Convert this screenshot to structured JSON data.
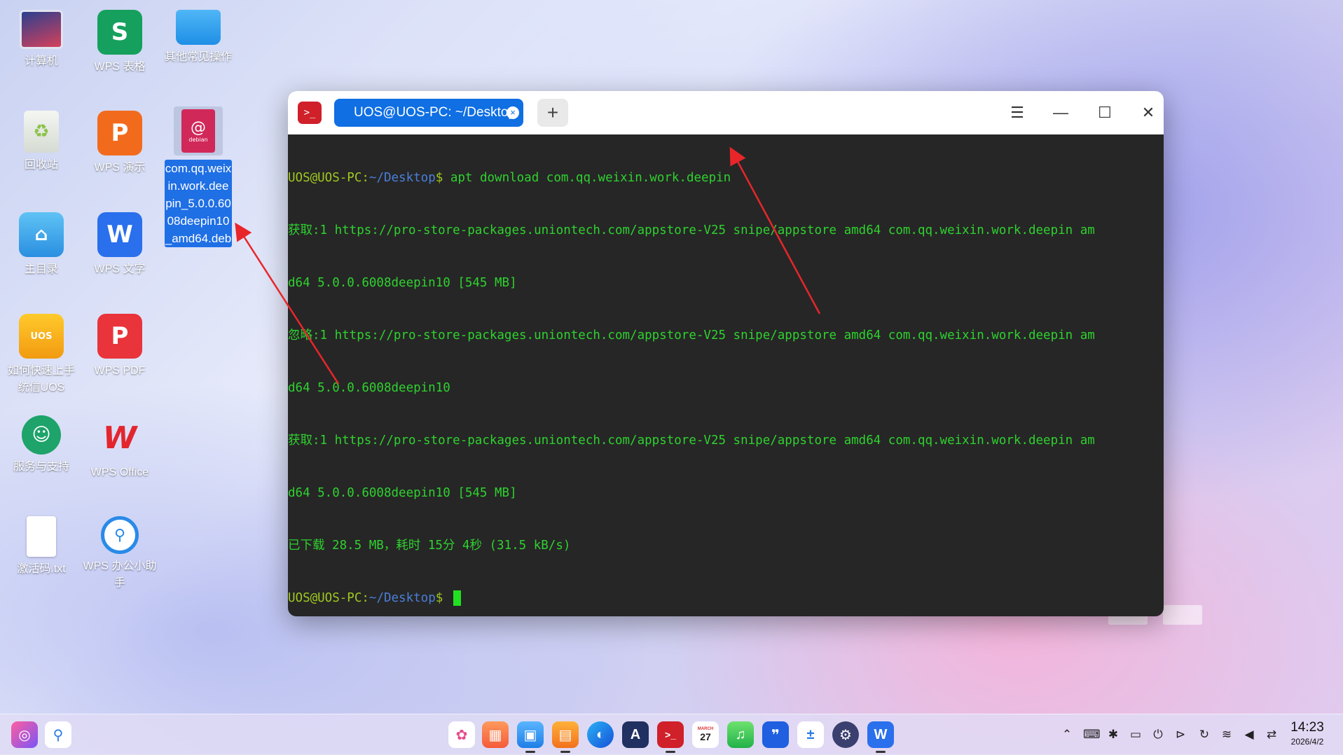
{
  "desktop": {
    "icons": [
      {
        "label": "计算机",
        "icon": "computer-icon"
      },
      {
        "label": "WPS 表格",
        "icon": "wps-spreadsheet-icon"
      },
      {
        "label": "其他常见操作",
        "icon": "folder-icon"
      },
      {
        "label": "回收站",
        "icon": "trash-icon"
      },
      {
        "label": "WPS 演示",
        "icon": "wps-presentation-icon"
      },
      {
        "label": "com.qq.weixin.work.deepin_5.0.0.6008deepin10_amd64.deb",
        "icon": "deb-package-icon"
      },
      {
        "label": "主目录",
        "icon": "home-folder-icon"
      },
      {
        "label": "WPS 文字",
        "icon": "wps-writer-icon"
      },
      {
        "label": "如何快速上手统信UOS",
        "icon": "uos-guide-icon"
      },
      {
        "label": "WPS PDF",
        "icon": "wps-pdf-icon"
      },
      {
        "label": "服务与支持",
        "icon": "support-icon"
      },
      {
        "label": "WPS Office",
        "icon": "wps-office-icon"
      },
      {
        "label": "激活码.txt",
        "icon": "text-file-icon"
      },
      {
        "label": "WPS 办公小助手",
        "icon": "wps-assistant-icon"
      }
    ],
    "deb_badge": "debian"
  },
  "terminal": {
    "app_icon_glyph": ">_",
    "tab_title": "UOS@UOS-PC: ~/Desktop",
    "tab_close_glyph": "×",
    "new_tab_glyph": "+",
    "menu_glyph": "☰",
    "minimize_glyph": "—",
    "maximize_glyph": "☐",
    "close_glyph": "✕",
    "prompt_user": "UOS@UOS-PC",
    "prompt_sep": ":",
    "prompt_path": "~/Desktop",
    "prompt_dollar": "$",
    "command": " apt download com.qq.weixin.work.deepin",
    "output_lines": [
      "获取:1 https://pro-store-packages.uniontech.com/appstore-V25 snipe/appstore amd64 com.qq.weixin.work.deepin am",
      "d64 5.0.0.6008deepin10 [545 MB]",
      "忽略:1 https://pro-store-packages.uniontech.com/appstore-V25 snipe/appstore amd64 com.qq.weixin.work.deepin am",
      "d64 5.0.0.6008deepin10",
      "获取:1 https://pro-store-packages.uniontech.com/appstore-V25 snipe/appstore amd64 com.qq.weixin.work.deepin am",
      "d64 5.0.0.6008deepin10 [545 MB]",
      "已下载 28.5 MB，耗时 15分 4秒 (31.5 kB/s)"
    ],
    "colors": {
      "text": "#2fd12f",
      "user": "#a0c81f",
      "path": "#4a7fd8",
      "background": "#262626"
    }
  },
  "dock": {
    "left": [
      "launcher-icon",
      "search-icon"
    ],
    "apps": [
      "color-palette-icon",
      "app-store-icon",
      "file-manager-icon",
      "app-market-icon",
      "browser-icon",
      "text-editor-icon",
      "terminal-icon",
      "calendar-icon",
      "music-icon",
      "quote-app-icon",
      "calculator-icon",
      "settings-icon",
      "wps-writer-icon"
    ],
    "calendar_day": "27",
    "calendar_month": "MARCH",
    "tray": [
      "chevron-up-icon",
      "keyboard-icon",
      "bluetooth-icon",
      "battery-icon",
      "power-icon",
      "play-icon",
      "sync-icon",
      "wifi-icon",
      "volume-muted-icon",
      "toggle-icon"
    ],
    "time": "14:23",
    "date": "2026/4/2"
  }
}
